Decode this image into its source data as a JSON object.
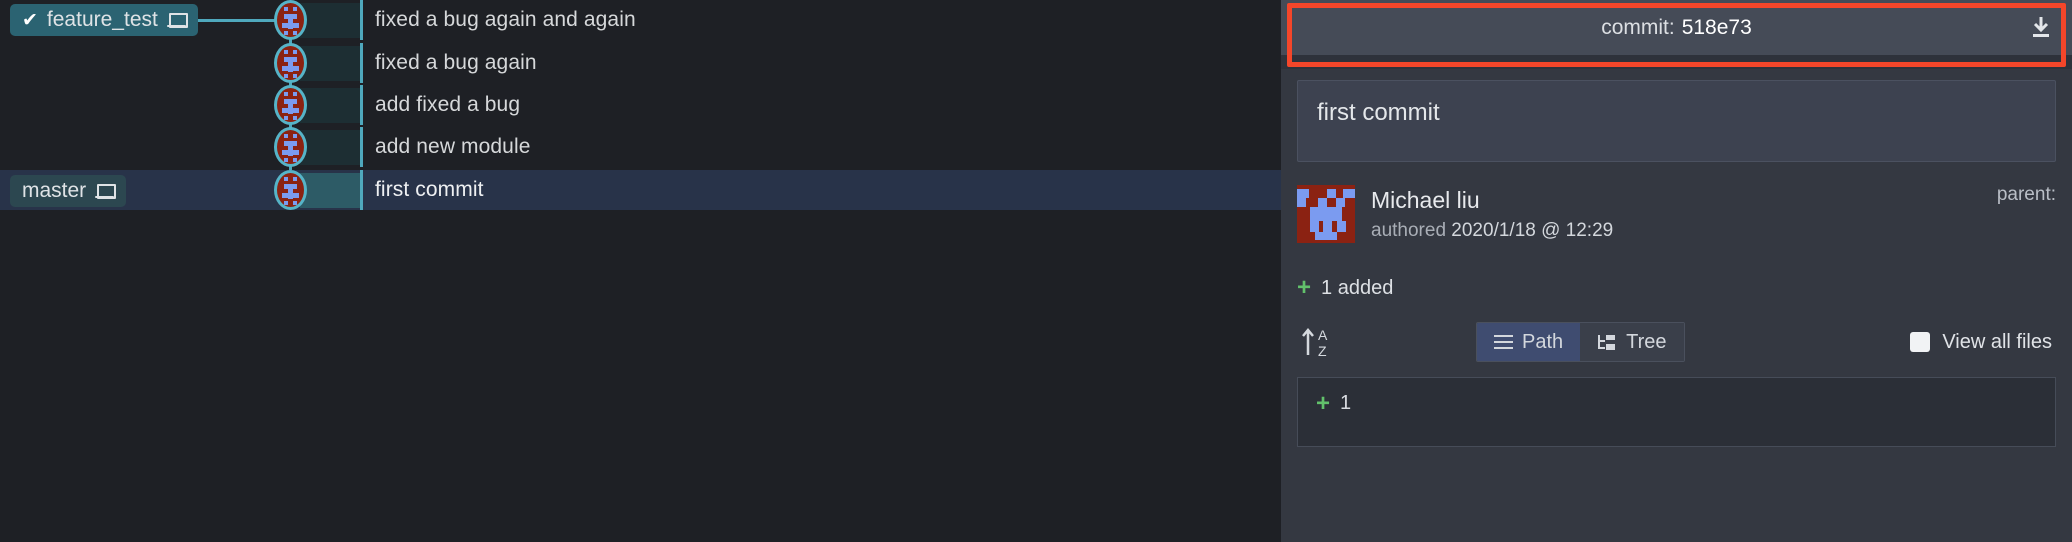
{
  "graph": {
    "branches": [
      {
        "name": "feature_test",
        "current": true,
        "check_icon": "check-icon",
        "device_icon": "laptop-icon"
      },
      {
        "name": "master",
        "current": false,
        "device_icon": "laptop-icon"
      }
    ],
    "commits": [
      {
        "message": "fixed a bug again and again",
        "selected": false
      },
      {
        "message": "fixed a bug again",
        "selected": false
      },
      {
        "message": "add fixed a bug",
        "selected": false
      },
      {
        "message": "add new module",
        "selected": false
      },
      {
        "message": "first commit",
        "selected": true
      }
    ]
  },
  "detail": {
    "header": {
      "prefix": "commit:",
      "hash": "518e73",
      "download_icon": "download-icon"
    },
    "message": "first commit",
    "author": {
      "name": "Michael liu",
      "authored_label": "authored",
      "authored_date": "2020/1/18 @ 12:29",
      "avatar_icon": "identicon-avatar"
    },
    "parent_label": "parent:",
    "changes": {
      "plus": "+",
      "summary": "1 added"
    },
    "toolbar": {
      "sort_icon": "sort-alpha-asc-icon",
      "path_label": "Path",
      "path_icon": "list-icon",
      "tree_label": "Tree",
      "tree_icon": "tree-icon",
      "view_all_label": "View all files",
      "view_all_checked": false
    },
    "files": [
      {
        "plus": "+",
        "name": "1"
      }
    ]
  },
  "colors": {
    "accent_teal": "#4fa8bd",
    "branch_current": "#2b6372",
    "selected_row": "#283349",
    "highlight_outline": "#f4462a",
    "added_green": "#62c16b",
    "panel_bg": "#343841"
  }
}
